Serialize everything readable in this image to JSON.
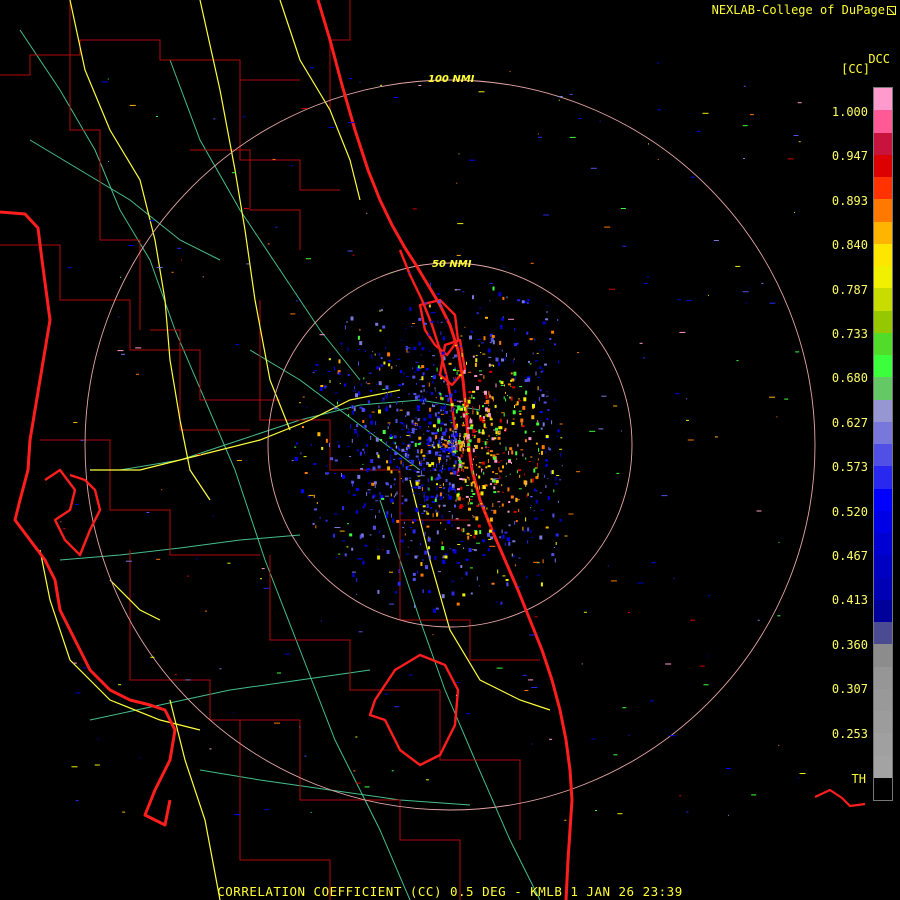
{
  "header": {
    "attribution": "NEXLAB-College of DuPage",
    "product_code": "DCC",
    "product_unit": "[CC]",
    "threshold_code": "TH"
  },
  "footer": {
    "title": "CORRELATION COEFFICIENT (CC) 0.5 DEG - KMLB 1 JAN 26 23:39"
  },
  "range_rings": {
    "inner_label": "50 NMI",
    "outer_label": "100 NMI"
  },
  "colorbar": {
    "ticks": [
      "1.000",
      "0.947",
      "0.893",
      "0.840",
      "0.787",
      "0.733",
      "0.680",
      "0.627",
      "0.573",
      "0.520",
      "0.467",
      "0.413",
      "0.360",
      "0.307",
      "0.253"
    ],
    "tick_values": [
      1.0,
      0.947,
      0.893,
      0.84,
      0.787,
      0.733,
      0.68,
      0.627,
      0.573,
      0.52,
      0.467,
      0.413,
      0.36,
      0.307,
      0.253
    ],
    "range": [
      0.2,
      1.05
    ],
    "colors": [
      "#ff9acd",
      "#ff5a96",
      "#c8143c",
      "#dc0000",
      "#ff3200",
      "#ff7800",
      "#ffb400",
      "#ffe600",
      "#f0f000",
      "#c8dc00",
      "#96c800",
      "#50dc28",
      "#3cff3c",
      "#64c864",
      "#9696d2",
      "#7878dc",
      "#5050e6",
      "#2828f0",
      "#0000ff",
      "#0000e6",
      "#0000d2",
      "#0000c3",
      "#0000b4",
      "#00009b",
      "#4b4b91",
      "#8c8c8c",
      "#969696",
      "#999999",
      "#9c9c9c",
      "#a0a0a0",
      "#a3a3a3",
      "#000000"
    ]
  },
  "colors": {
    "coastline": "#ff1e1e",
    "county_lines": "#b40a0a",
    "highways": "#ffff3c",
    "roads": "#46be8c",
    "range_rings": "#e8a8a8",
    "label_text": "#ffff33"
  }
}
